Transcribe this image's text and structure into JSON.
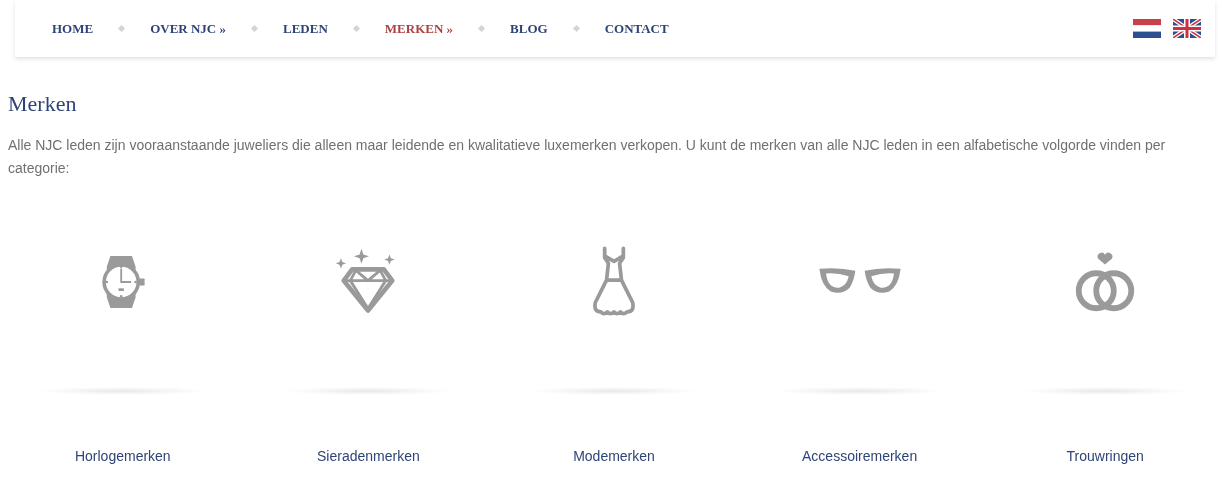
{
  "nav": {
    "items": [
      {
        "label": "HOME",
        "selected": false
      },
      {
        "label": "OVER NJC »",
        "selected": false
      },
      {
        "label": "LEDEN",
        "selected": false
      },
      {
        "label": "MERKEN »",
        "selected": true
      },
      {
        "label": "BLOG",
        "selected": false
      },
      {
        "label": "CONTACT",
        "selected": false
      }
    ]
  },
  "page": {
    "title": "Merken",
    "intro": "Alle NJC leden zijn vooraanstaande juweliers die alleen maar leidende en kwalitatieve luxemerken verkopen. U kunt de merken van alle NJC leden in een alfabetische volgorde vinden per categorie:"
  },
  "categories": [
    {
      "label": "Horlogemerken",
      "kind": "watch"
    },
    {
      "label": "Sieradenmerken",
      "kind": "diamond"
    },
    {
      "label": "Modemerken",
      "kind": "dress"
    },
    {
      "label": "Accessoiremerken",
      "kind": "glasses"
    },
    {
      "label": "Trouwringen",
      "kind": "rings"
    }
  ]
}
